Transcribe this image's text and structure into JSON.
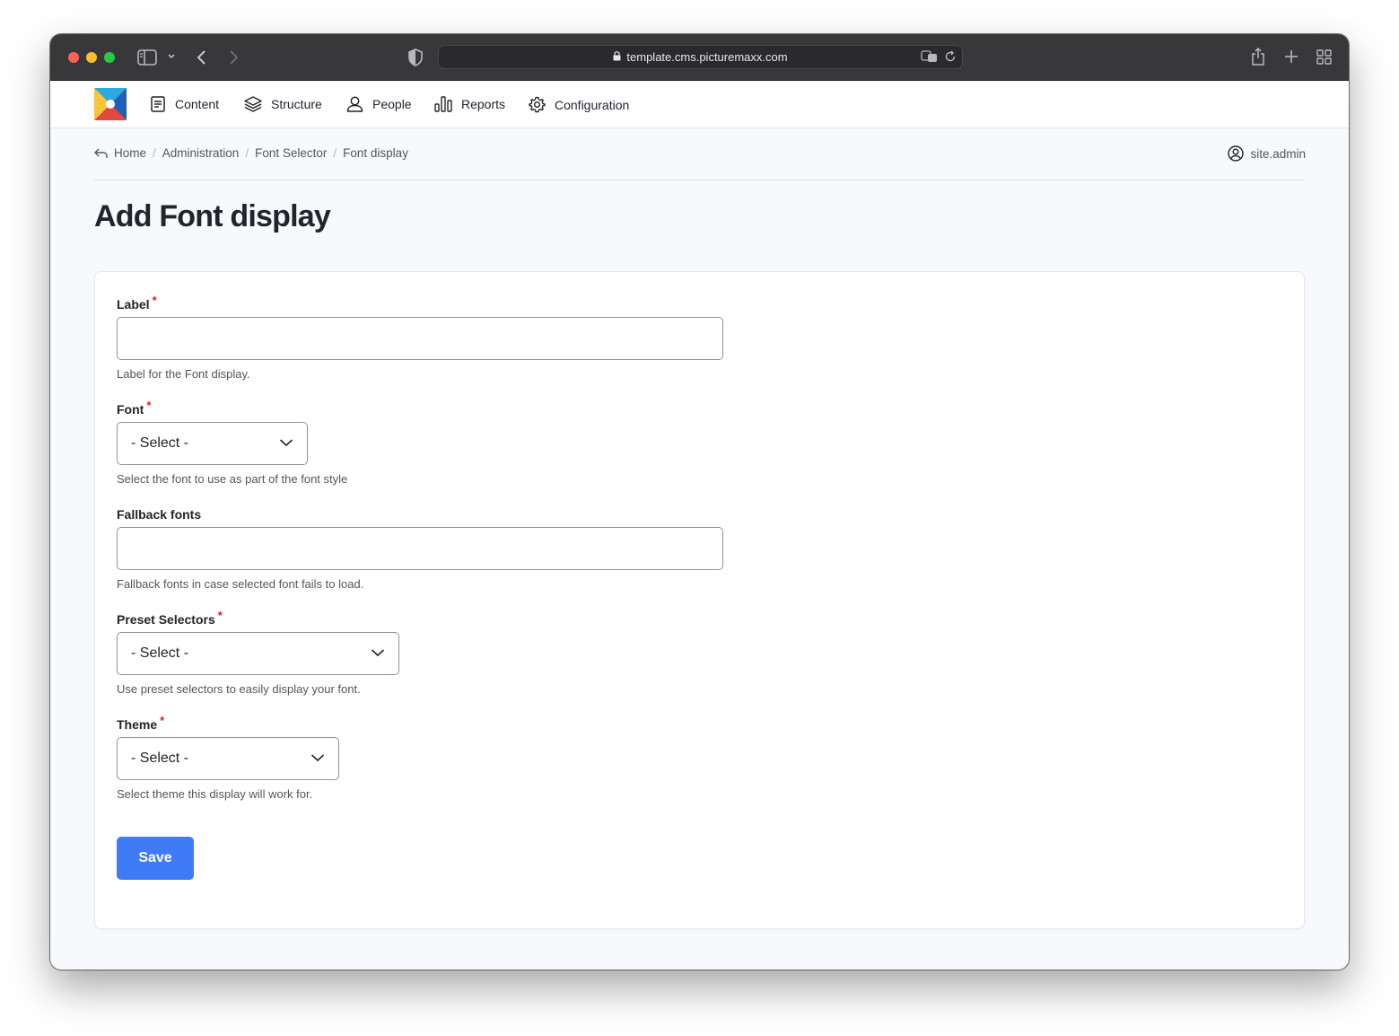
{
  "browser": {
    "url": "template.cms.picturemaxx.com"
  },
  "nav": {
    "items": [
      {
        "label": "Content",
        "icon": "document-icon"
      },
      {
        "label": "Structure",
        "icon": "layers-icon"
      },
      {
        "label": "People",
        "icon": "person-icon"
      },
      {
        "label": "Reports",
        "icon": "bar-chart-icon"
      },
      {
        "label": "Configuration",
        "icon": "gear-icon"
      }
    ]
  },
  "breadcrumb": {
    "items": [
      "Home",
      "Administration",
      "Font Selector",
      "Font display"
    ],
    "separator": "/"
  },
  "user": {
    "name": "site.admin"
  },
  "page": {
    "title": "Add Font display"
  },
  "form": {
    "label_field": {
      "label": "Label",
      "required_mark": "*",
      "value": "",
      "description": "Label for the Font display."
    },
    "font_field": {
      "label": "Font",
      "required_mark": "*",
      "selected": "- Select -",
      "description": "Select the font to use as part of the font style"
    },
    "fallback_field": {
      "label": "Fallback fonts",
      "value": "",
      "description": "Fallback fonts in case selected font fails to load."
    },
    "preset_field": {
      "label": "Preset Selectors",
      "required_mark": "*",
      "selected": "- Select -",
      "description": "Use preset selectors to easily display your font."
    },
    "theme_field": {
      "label": "Theme",
      "required_mark": "*",
      "selected": "- Select -",
      "description": "Select theme this display will work for."
    },
    "save_label": "Save"
  },
  "colors": {
    "accent": "#3f7af7",
    "required": "#d72222",
    "background": "#f7f9fd"
  }
}
